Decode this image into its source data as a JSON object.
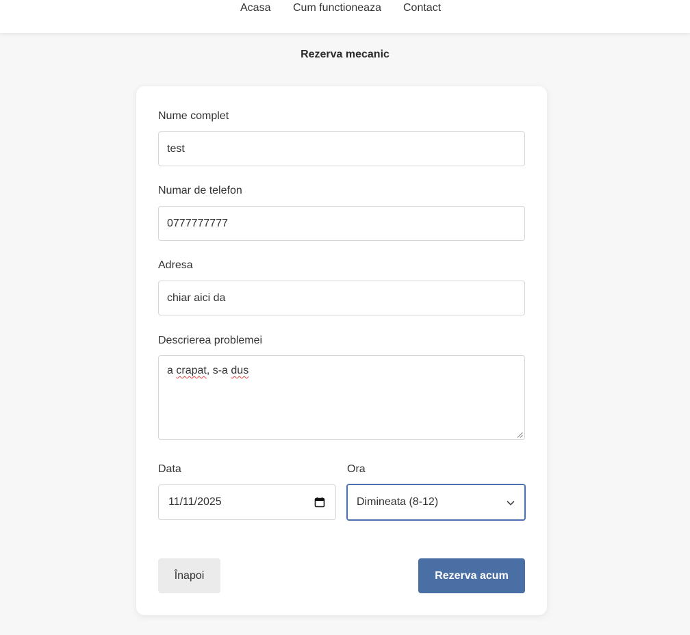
{
  "nav": {
    "items": [
      {
        "label": "Acasa"
      },
      {
        "label": "Cum functioneaza"
      },
      {
        "label": "Contact"
      }
    ]
  },
  "page": {
    "title": "Rezerva mecanic"
  },
  "form": {
    "name": {
      "label": "Nume complet",
      "value": "test"
    },
    "phone": {
      "label": "Numar de telefon",
      "value": "0777777777"
    },
    "address": {
      "label": "Adresa",
      "value": "chiar aici da"
    },
    "description": {
      "label": "Descrierea problemei",
      "value_word1": "a",
      "value_word2": "crapat",
      "value_word3": ", s-a",
      "value_word4": "dus"
    },
    "date": {
      "label": "Data",
      "value": "11/11/2025"
    },
    "time": {
      "label": "Ora",
      "value": "Dimineata (8-12)"
    }
  },
  "buttons": {
    "back": "Înapoi",
    "submit": "Rezerva acum"
  },
  "icons": {
    "date": "calendar-icon",
    "select": "chevron-down-icon"
  },
  "colors": {
    "primary": "#4a6fa5",
    "focus_border": "#4a6fb0",
    "background": "#f7f7f7"
  }
}
